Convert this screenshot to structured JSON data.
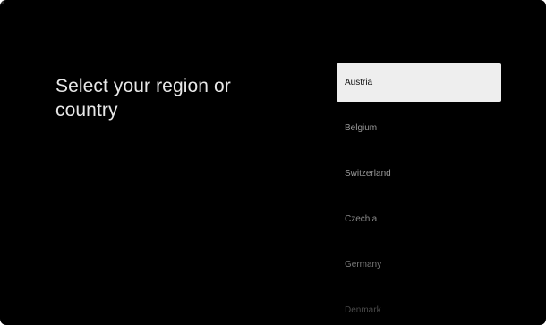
{
  "page": {
    "title": "Select your region or country"
  },
  "regions": {
    "items": [
      {
        "label": "Austria",
        "selected": true
      },
      {
        "label": "Belgium",
        "selected": false
      },
      {
        "label": "Switzerland",
        "selected": false
      },
      {
        "label": "Czechia",
        "selected": false
      },
      {
        "label": "Germany",
        "selected": false
      },
      {
        "label": "Denmark",
        "selected": false
      }
    ]
  },
  "colors": {
    "background": "#000000",
    "selected_background": "#eeeeee",
    "selected_text": "#111111",
    "title_text": "#e8e8e8",
    "item_text": "#9a9a9a"
  }
}
